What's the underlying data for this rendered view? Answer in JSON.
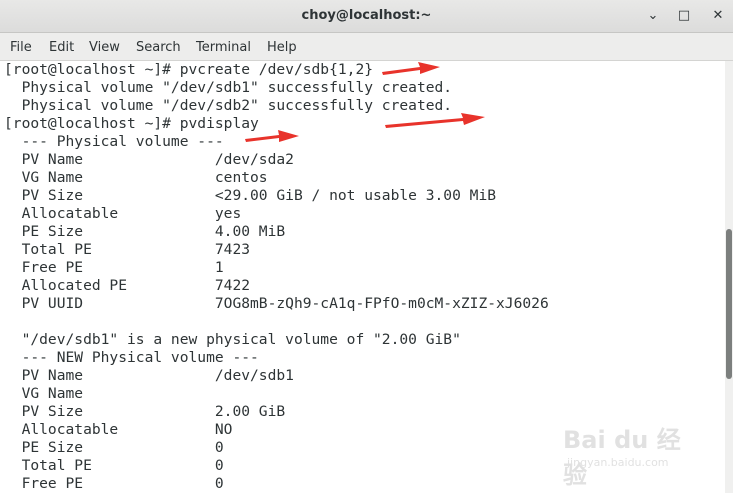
{
  "window": {
    "title": "choy@localhost:~",
    "minimize_glyph": "⌄",
    "maximize_glyph": "□",
    "close_glyph": "✕"
  },
  "menu": [
    "File",
    "Edit",
    "View",
    "Search",
    "Terminal",
    "Help"
  ],
  "terminal_lines": [
    "[root@localhost ~]# pvcreate /dev/sdb{1,2}",
    "  Physical volume \"/dev/sdb1\" successfully created.",
    "  Physical volume \"/dev/sdb2\" successfully created.",
    "[root@localhost ~]# pvdisplay",
    "  --- Physical volume ---",
    "  PV Name               /dev/sda2",
    "  VG Name               centos",
    "  PV Size               <29.00 GiB / not usable 3.00 MiB",
    "  Allocatable           yes",
    "  PE Size               4.00 MiB",
    "  Total PE              7423",
    "  Free PE               1",
    "  Allocated PE          7422",
    "  PV UUID               7OG8mB-zQh9-cA1q-FPfO-m0cM-xZIZ-xJ6026",
    "",
    "  \"/dev/sdb1\" is a new physical volume of \"2.00 GiB\"",
    "  --- NEW Physical volume ---",
    "  PV Name               /dev/sdb1",
    "  VG Name               ",
    "  PV Size               2.00 GiB",
    "  Allocatable           NO",
    "  PE Size               0",
    "  Total PE              0",
    "  Free PE               0"
  ],
  "watermark": {
    "brand": "Bai du 经验",
    "url": "jingyan.baidu.com"
  },
  "colors": {
    "annotation_arrow": "#e8332b",
    "terminal_text": "#2e3436",
    "terminal_bg": "#ffffff"
  }
}
